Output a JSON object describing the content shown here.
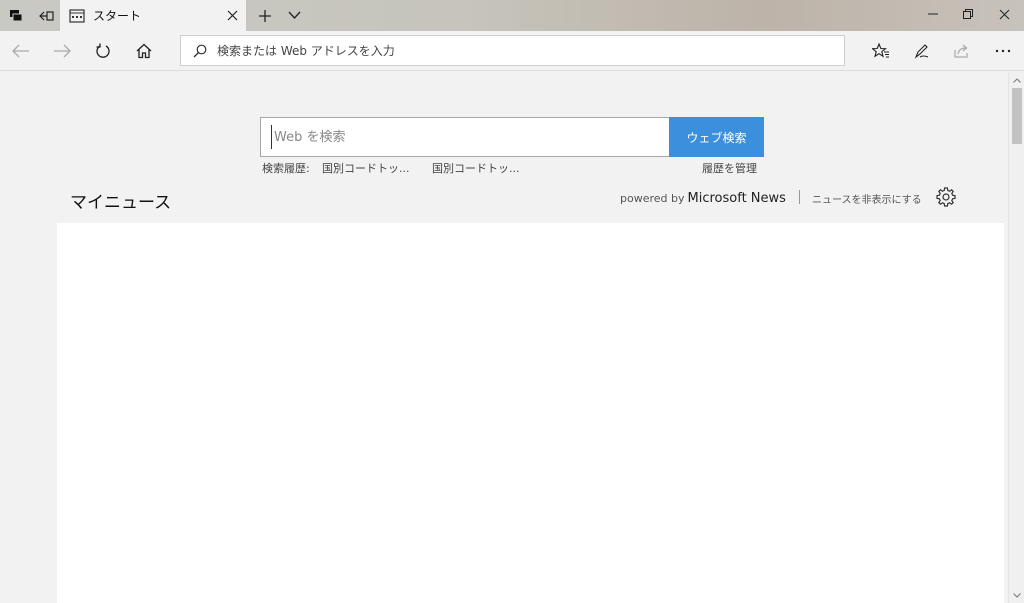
{
  "tab": {
    "title": "スタート"
  },
  "address_bar": {
    "placeholder": "検索または Web アドレスを入力"
  },
  "search": {
    "placeholder": "Web を検索",
    "button_label": "ウェブ検索"
  },
  "history": {
    "label": "検索履歴:",
    "items": [
      "国別コードトッ...",
      "国別コードトッ..."
    ],
    "manage_label": "履歴を管理"
  },
  "news": {
    "title": "マイニュース",
    "powered_by": "powered by",
    "brand": "Microsoft News",
    "hide_label": "ニュースを非表示にする"
  },
  "colors": {
    "accent": "#3c8fdc"
  }
}
